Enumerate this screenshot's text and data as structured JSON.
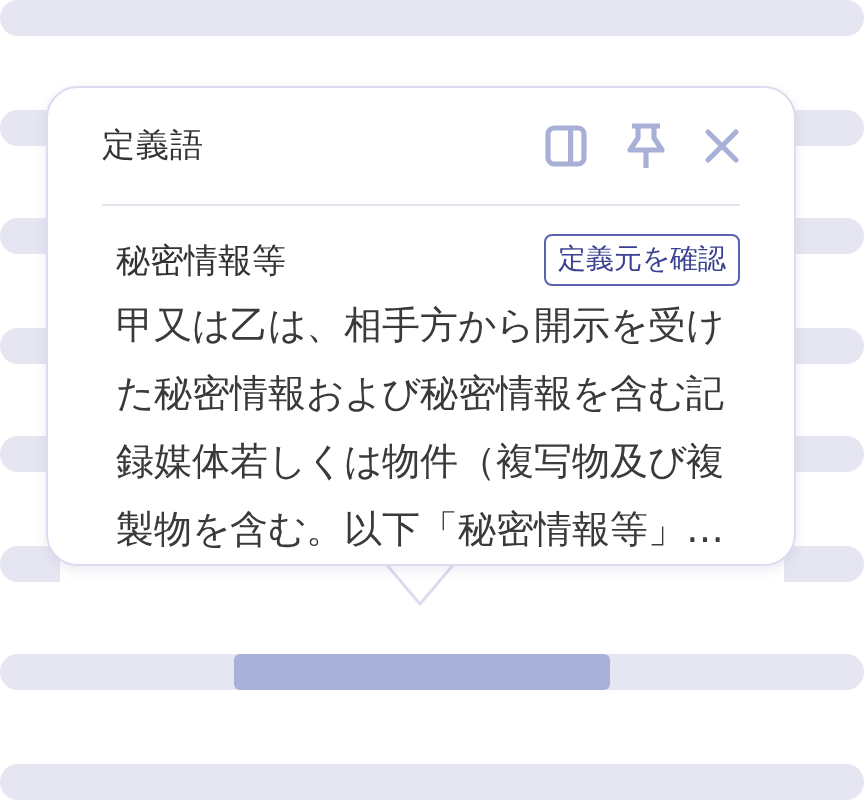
{
  "popover": {
    "title": "定義語",
    "term": "秘密情報等",
    "source_button": "定義元を確認",
    "definition": "甲又は乙は、相手方から開示を受けた秘密情報および秘密情報を含む記録媒体若しくは物件（複写物及び複製物を含む。以下「秘密情報等」…"
  }
}
